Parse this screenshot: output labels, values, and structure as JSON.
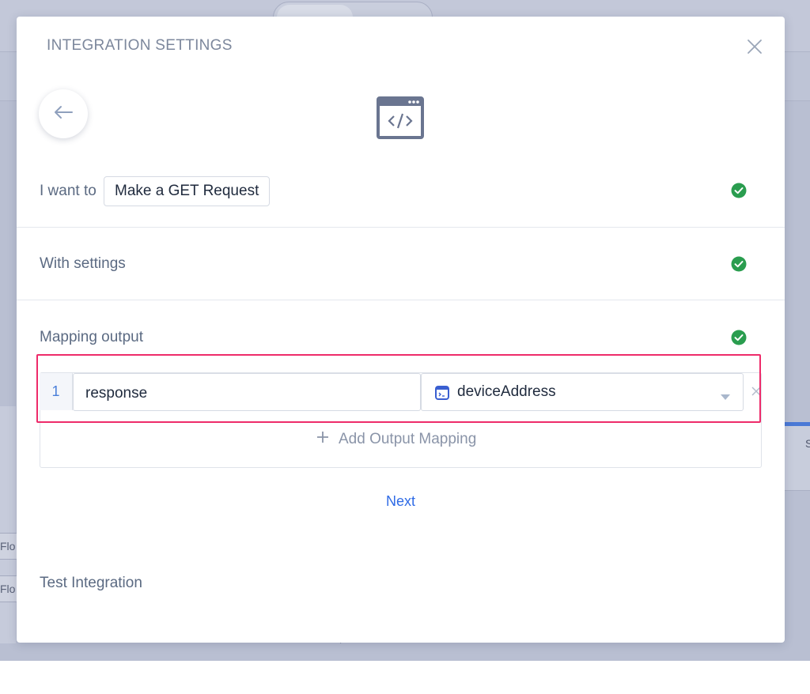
{
  "background": {
    "flow_items": [
      "Flo",
      "Flo"
    ],
    "right_panel_label": "S"
  },
  "modal": {
    "title": "INTEGRATION SETTINGS",
    "close_icon": "close-icon",
    "back_icon": "arrow-left-icon",
    "integration_icon": "code-window-icon"
  },
  "step_action": {
    "label": "I want to",
    "value": "Make a GET Request",
    "status_icon": "check-circle-icon"
  },
  "step_settings": {
    "label": "With settings",
    "status_icon": "check-circle-icon"
  },
  "step_mapping": {
    "label": "Mapping output",
    "status_icon": "check-circle-icon",
    "rows": [
      {
        "index": "1",
        "output_name": "response",
        "variable_icon": "variable-icon",
        "variable": "deviceAddress",
        "remove_icon": "close-icon"
      }
    ],
    "add_label": "Add Output Mapping",
    "add_icon": "plus-icon"
  },
  "next_label": "Next",
  "test_label": "Test Integration",
  "colors": {
    "accent": "#2f6be6",
    "success": "#2a9d4f",
    "highlight": "#ee2b6a",
    "muted_text": "#5b6a82"
  }
}
